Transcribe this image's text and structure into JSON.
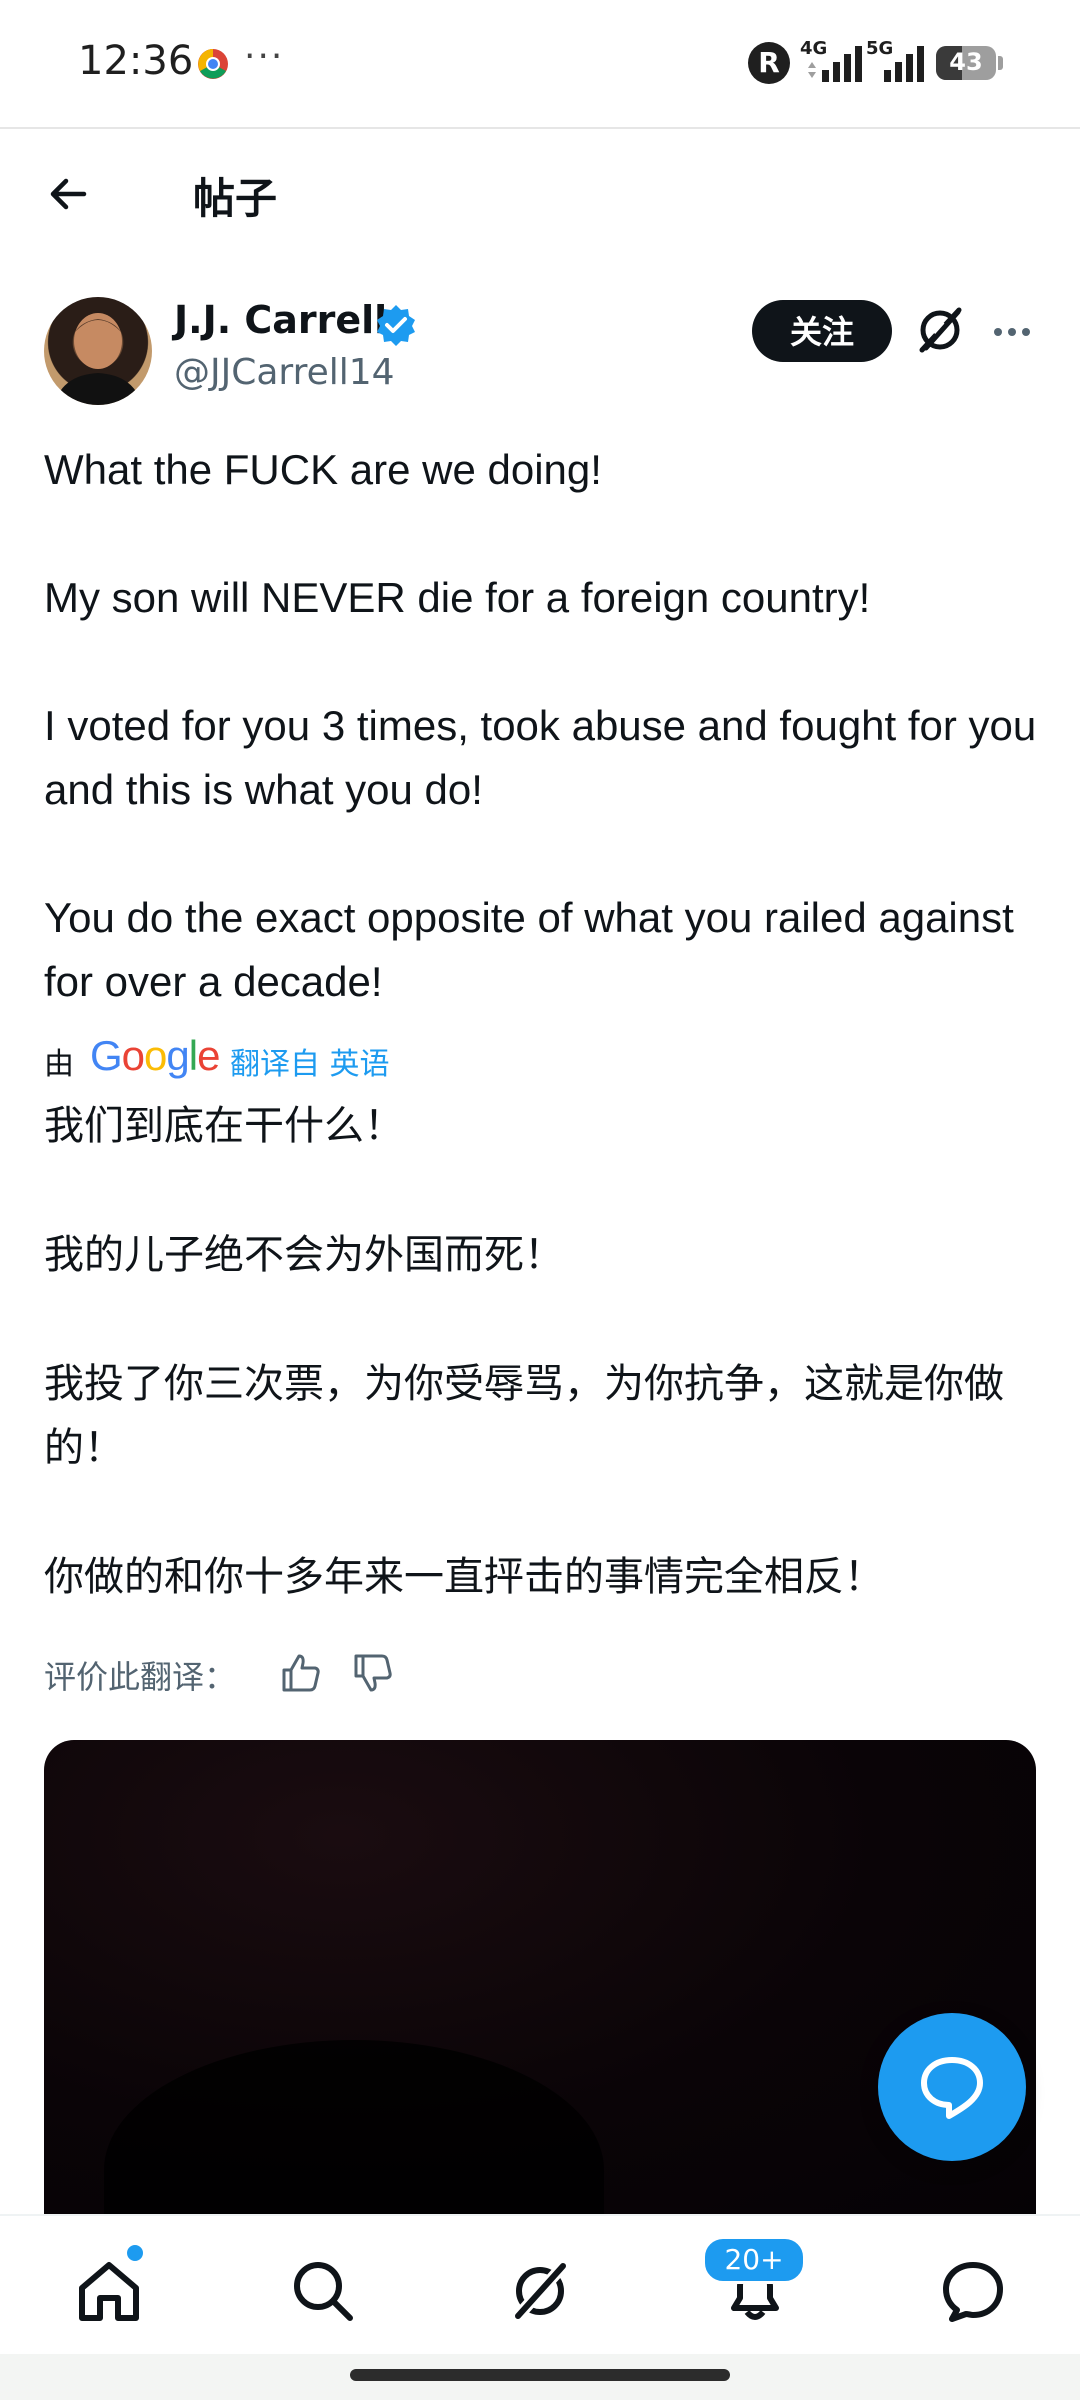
{
  "status_bar": {
    "time": "12:36",
    "overflow": "···",
    "r_badge": "R",
    "signal_1_label": "4G",
    "signal_2_label": "5G",
    "battery_level": "43",
    "battery_fraction": 0.43,
    "icons": [
      "chrome-icon",
      "r-icon",
      "signal-4g-icon",
      "signal-5g-icon",
      "battery-icon"
    ]
  },
  "header": {
    "title": "帖子",
    "back_icon": "arrow-left-icon"
  },
  "author": {
    "name": "J.J. Carrell",
    "handle": "@JJCarrell14",
    "verified": true,
    "follow_label": "关注"
  },
  "post": {
    "original": [
      "What the FUCK are we doing!",
      "My son will NEVER die for a foreign country!",
      "I voted for you 3 times, took abuse and fought for you and this is what you do!",
      "You do the exact opposite of what you railed against for over a decade!"
    ],
    "translation_by": "由",
    "translation_provider": "Google",
    "translated_from": "翻译自 英语",
    "translated": [
      "我们到底在干什么！",
      "我的儿子绝不会为外国而死！",
      "我投了你三次票，为你受辱骂，为你抗争，这就是你做的！",
      "你做的和你十多年来一直抨击的事情完全相反！"
    ],
    "rate_label": "评价此翻译："
  },
  "nav": {
    "notifications_badge": "20+",
    "items": [
      "home-icon",
      "search-icon",
      "grok-icon",
      "notifications-icon",
      "messages-icon"
    ]
  },
  "colors": {
    "accent": "#1d9bf0",
    "text": "#0f1419",
    "secondary": "#536471"
  }
}
